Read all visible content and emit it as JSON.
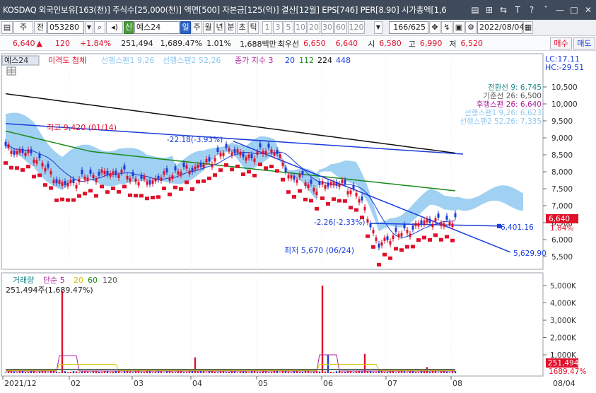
{
  "titlebar": {
    "text": "KOSDAQ 외국인보유[163(천)] 주식수[25,000(천)] 액면[500] 자본금[125(억)] 결산[12월] EPS[746] PER[8.90] 시가총액[1,6",
    "buttons": [
      "▤",
      "⊞",
      "⇆",
      "T",
      "?",
      "ˇ",
      "—",
      "□",
      "✕"
    ]
  },
  "toolbar": {
    "tab1": "주",
    "tab2": "전",
    "code": "053280",
    "search_icon": "magnifier-icon",
    "badge": "신",
    "stock_name": "예스24",
    "periods": [
      "일",
      "주",
      "월",
      "년",
      "분",
      "초",
      "틱"
    ],
    "numbers": [
      "1",
      "3",
      "5",
      "10",
      "20",
      "30",
      "60",
      "120"
    ],
    "count": "166/625",
    "date": "2022/08/04"
  },
  "infobar": {
    "price": "6,640",
    "arrow": "▲",
    "change": "120",
    "change_pct": "+1.84%",
    "volume": "251,494",
    "vol_pct": "1,689.47%",
    "turnover_pct": "1.01%",
    "amount": "1,688백만",
    "pref_label": "최우선",
    "pref_sell": "6,650",
    "pref_buy": "6,640",
    "open_label": "시",
    "open": "6,580",
    "high_label": "고",
    "high": "6,990",
    "low_label": "저",
    "low": "6,520"
  },
  "side": {
    "buy": "매수",
    "sell": "매도"
  },
  "legend": {
    "name": "예스24",
    "items": [
      {
        "text": "이격도 첨체",
        "color": "#e0102a"
      },
      {
        "text": "선행스팬1 9,26",
        "color": "#8fc8f0"
      },
      {
        "text": "선행스팬2 52,26",
        "color": "#8fc8f0"
      },
      {
        "text": "종가 지수 3",
        "color": "#b0209a"
      },
      {
        "text": "20",
        "color": "#1a3ddb"
      },
      {
        "text": "112",
        "color": "#1a8a1a"
      },
      {
        "text": "224",
        "color": "#111111"
      },
      {
        "text": "448",
        "color": "#1a3ddb"
      }
    ],
    "lc": "LC:17.11",
    "hc": "HC:-29.51"
  },
  "right_labels": [
    {
      "text": "전환선 9: 6,745",
      "color": "#1a8a8a"
    },
    {
      "text": "기준선 26: 6,500",
      "color": "#555555"
    },
    {
      "text": "후행스팬 26: 6,640",
      "color": "#b0209a"
    },
    {
      "text": "선행스팬1 9,26: 6,623",
      "color": "#8fc8f0"
    },
    {
      "text": "선행스팬2 52,26: 7,335",
      "color": "#8fc8f0"
    }
  ],
  "annotations": {
    "high": "최고 9,420 (01/14)",
    "low": "최저 5,670 (06/24)",
    "pct1": "-22.18(-3.93%)",
    "pct2": "-2.26(-2.33%)",
    "trend1": "6,401.16",
    "trend2": "5,629.90"
  },
  "price_axis": {
    "ticks": [
      "10,500",
      "10,000",
      "9,500",
      "9,000",
      "8,500",
      "8,000",
      "7,500",
      "7,000",
      "6,500",
      "6,000",
      "5,500"
    ],
    "current": "6,640",
    "current_pct": "1.84%"
  },
  "volume_panel": {
    "legend": [
      {
        "text": "거래량",
        "color": "#1a8a8a"
      },
      {
        "text": "단순 5",
        "color": "#b0209a"
      },
      {
        "text": "20",
        "color": "#d4c400"
      },
      {
        "text": "60",
        "color": "#1a8a1a"
      },
      {
        "text": "120",
        "color": "#555555"
      }
    ],
    "value": "251,494주(1,689.47%)",
    "ticks": [
      "5,000K",
      "4,000K",
      "3,000K",
      "2,000K",
      "1,000K"
    ],
    "current": "251,494",
    "current_pct": "1689.47%"
  },
  "x_axis": {
    "labels": [
      "2021/12",
      "02",
      "03",
      "04",
      "05",
      "06",
      "07",
      "08"
    ],
    "right_label": "08/04"
  },
  "colors": {
    "up": "#e0102a",
    "down": "#1a3ddb",
    "cloud": "#8fc8f0",
    "ma20": "#1a3ddb",
    "ma112": "#1a8a1a",
    "ma224": "#111111"
  }
}
